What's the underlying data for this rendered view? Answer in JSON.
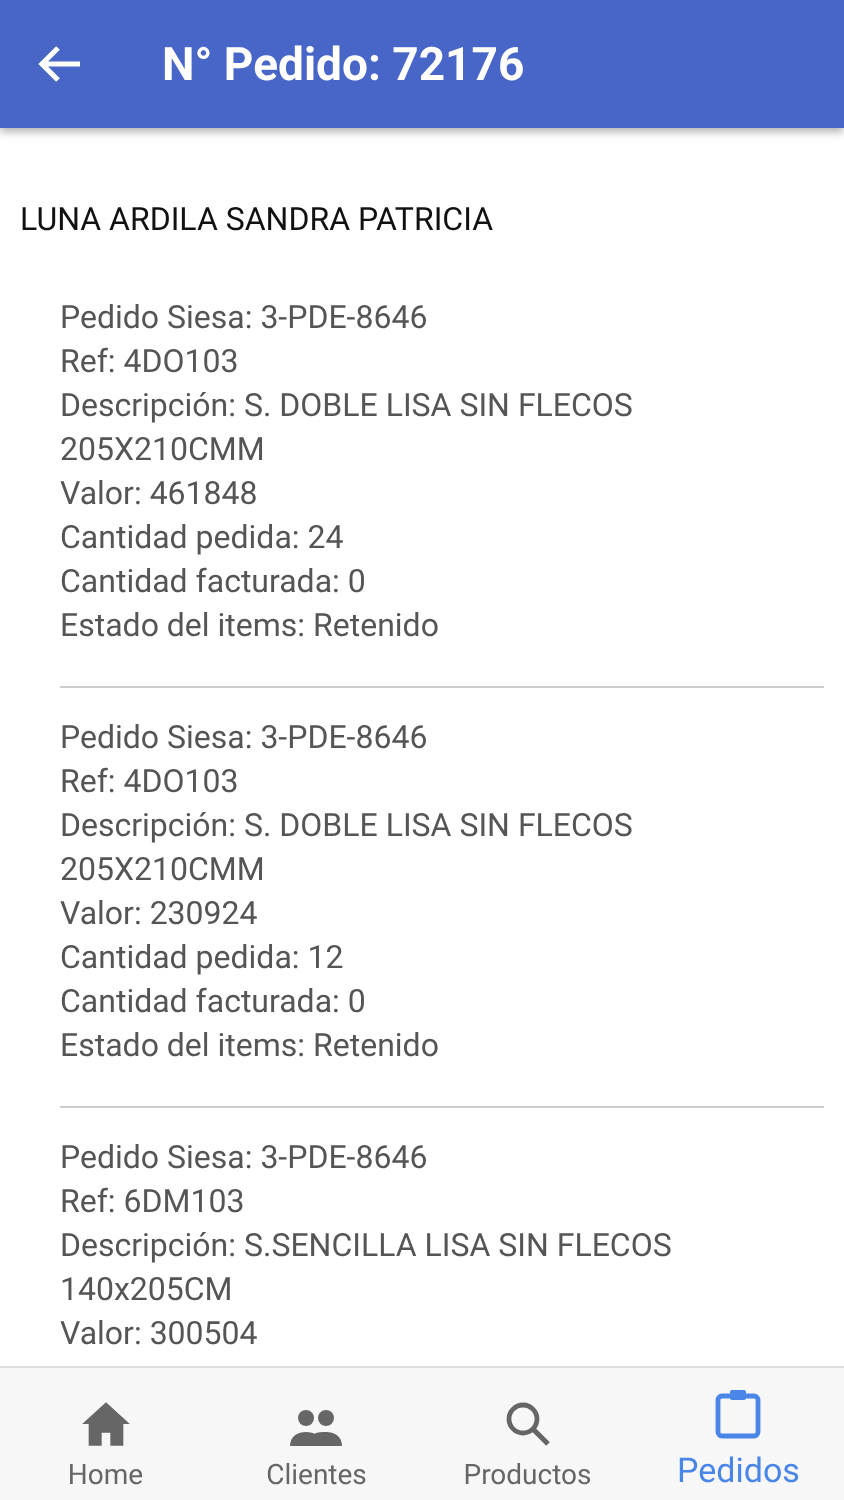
{
  "app_bar": {
    "title": "N° Pedido: 72176"
  },
  "customer": "LUNA ARDILA SANDRA PATRICIA",
  "items": [
    {
      "lines": [
        "Pedido Siesa: 3-PDE-8646",
        "Ref: 4DO103",
        "Descripción: S. DOBLE LISA SIN FLECOS 205X210CMM",
        "Valor: 461848",
        "Cantidad pedida: 24",
        "Cantidad facturada: 0",
        "Estado del items: Retenido"
      ]
    },
    {
      "lines": [
        "Pedido Siesa: 3-PDE-8646",
        "Ref: 4DO103",
        "Descripción: S. DOBLE LISA SIN FLECOS 205X210CMM",
        "Valor: 230924",
        "Cantidad pedida: 12",
        "Cantidad facturada: 0",
        "Estado del items: Retenido"
      ]
    },
    {
      "lines": [
        "Pedido Siesa: 3-PDE-8646",
        "Ref: 6DM103",
        "Descripción: S.SENCILLA LISA SIN FLECOS 140x205CM",
        "Valor: 300504"
      ]
    }
  ],
  "bottom_nav": [
    {
      "kind": "home",
      "label": "Home",
      "selected": false
    },
    {
      "kind": "clients",
      "label": "Clientes",
      "selected": false
    },
    {
      "kind": "search",
      "label": "Productos",
      "selected": false
    },
    {
      "kind": "orders",
      "label": "Pedidos",
      "selected": true
    }
  ]
}
